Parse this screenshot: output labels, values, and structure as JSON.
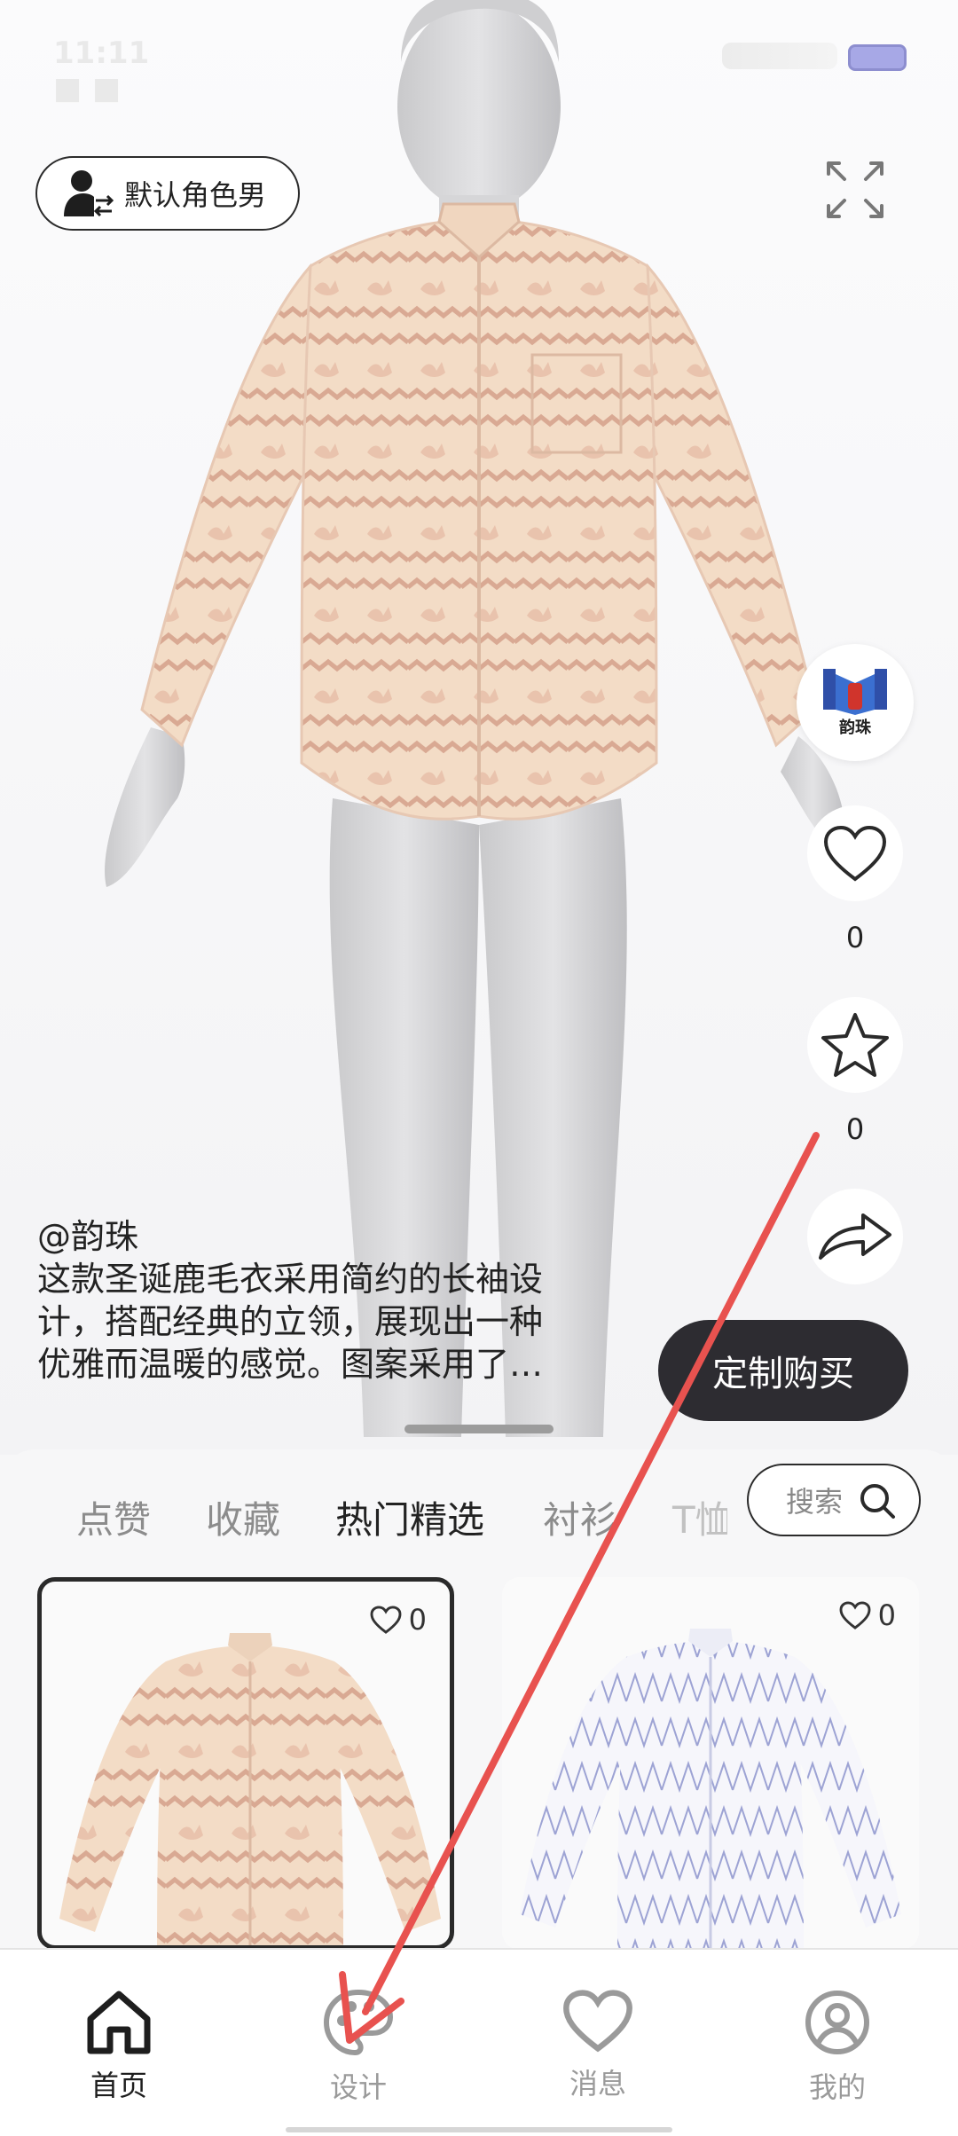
{
  "status_bar": {
    "time": "11:11 ■ ■",
    "battery": ""
  },
  "viewer": {
    "role_button": {
      "label": "默认角色男",
      "icon": "user-swap-icon"
    },
    "expand_icon": "fullscreen-expand-icon",
    "author_avatar": {
      "icon": "brand-logo-icon",
      "logo_text": "韵珠"
    },
    "like": {
      "icon": "heart-icon",
      "count": "0"
    },
    "favorite": {
      "icon": "star-icon",
      "count": "0"
    },
    "share": {
      "icon": "share-arrow-icon"
    },
    "caption": {
      "author": "@韵珠",
      "description_line1": "这款圣诞鹿毛衣采用简约的长袖设",
      "description_line2": "计，搭配经典的立领，展现出一种",
      "description_line3": "优雅而温暖的感觉。图案采用了…"
    },
    "buy_button": "定制购买"
  },
  "tabs": [
    {
      "label": "点赞",
      "active": false
    },
    {
      "label": "收藏",
      "active": false
    },
    {
      "label": "热门精选",
      "active": true
    },
    {
      "label": "衬衫",
      "active": false
    },
    {
      "label": "T恤",
      "active": false
    }
  ],
  "search": {
    "label": "搜索",
    "icon": "search-icon"
  },
  "cards": [
    {
      "likes": "0",
      "selected": true,
      "pattern": "beige reindeer knit shirt"
    },
    {
      "likes": "0",
      "selected": false,
      "pattern": "white blue zigzag shirt"
    }
  ],
  "bottom_nav": [
    {
      "label": "首页",
      "icon": "home-icon",
      "active": true
    },
    {
      "label": "设计",
      "icon": "palette-icon",
      "active": false
    },
    {
      "label": "消息",
      "icon": "heart-outline-icon",
      "active": false
    },
    {
      "label": "我的",
      "icon": "profile-icon",
      "active": false
    }
  ],
  "colors": {
    "accent_dark": "#2d2c31",
    "annotation_arrow": "#e8524f",
    "shirt_beige": "#f3dcc6",
    "shirt_stripe": "#d9a993"
  }
}
